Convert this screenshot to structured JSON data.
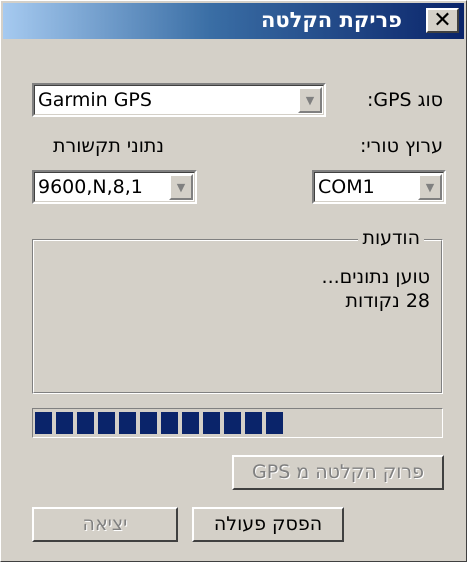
{
  "window": {
    "title": "פריקת הקלטה",
    "close_symbol": "✕"
  },
  "gps_type": {
    "label": "סוג GPS:",
    "value": "Garmin GPS"
  },
  "serial_port": {
    "label": "ערוץ טורי:",
    "value": "COM1"
  },
  "comm_settings": {
    "label": "נתוני תקשורת",
    "value": "9600,N,8,1"
  },
  "messages": {
    "legend": "הודעות",
    "lines": [
      "טוען נתונים...",
      "28 נקודות"
    ]
  },
  "progress": {
    "filled_segments": 12,
    "color": "#0a246a"
  },
  "buttons": {
    "download_label": "פרוק הקלטה מ GPS",
    "stop_label": "הפסק פעולה",
    "exit_label": "יציאה"
  },
  "icons": {
    "dropdown": "chevron-down-icon",
    "close": "close-icon"
  }
}
